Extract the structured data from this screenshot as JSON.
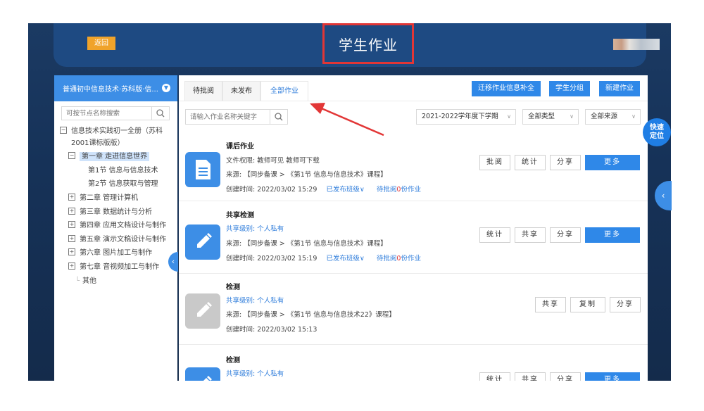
{
  "header": {
    "back_label": "返回",
    "title": "学生作业"
  },
  "sidebar": {
    "course": "普通初中信息技术·苏科版·信...",
    "search_placeholder": "可按节点名称搜索",
    "tree": [
      {
        "label": "信息技术实践初一全册（苏科",
        "expander": "−"
      },
      {
        "label": "2001课标版版）"
      },
      {
        "label": "第一章 走进信息世界",
        "expander": "−",
        "selected": true
      },
      {
        "label": "第1节 信息与信息技术"
      },
      {
        "label": "第2节 信息获取与管理"
      },
      {
        "label": "第二章 管理计算机",
        "expander": "+"
      },
      {
        "label": "第三章 数据统计与分析",
        "expander": "+"
      },
      {
        "label": "第四章 应用文档设计与制作",
        "expander": "+"
      },
      {
        "label": "第五章 演示文稿设计与制作",
        "expander": "+"
      },
      {
        "label": "第六章 图片加工与制作",
        "expander": "+"
      },
      {
        "label": "第七章 音视频加工与制作",
        "expander": "+"
      },
      {
        "label": "其他"
      }
    ]
  },
  "tabs": [
    "待批阅",
    "未发布",
    "全部作业"
  ],
  "active_tab": "全部作业",
  "toolbar": {
    "migrate": "迁移作业信息补全",
    "group": "学生分组",
    "new": "新建作业"
  },
  "filters": {
    "search_placeholder": "请输入作业名称关键字",
    "term": "2021-2022学年度下学期",
    "type": "全部类型",
    "source": "全部来源"
  },
  "float": {
    "locate": "快速定位"
  },
  "cards": [
    {
      "title": "课后作业",
      "line1": "文件权限:  教师可见  教师可下载",
      "source": "来源:   【同步备课 > 《第1节 信息与信息技术》课程】",
      "created": "创建时间:   2022/03/02 15:29",
      "published": "已发布班级∨",
      "pending_pre": "待批阅",
      "pending_num": "0",
      "pending_post": "份作业",
      "buttons": [
        "批阅",
        "统计",
        "分享",
        "更多"
      ]
    },
    {
      "title": "共享检测",
      "line1": "共享级别:  个人私有",
      "source": "来源:   【同步备课 > 《第1节 信息与信息技术》课程】",
      "created": "创建时间:   2022/03/02 15:19",
      "published": "已发布班级∨",
      "pending_pre": "待批阅",
      "pending_num": "0",
      "pending_post": "份作业",
      "buttons": [
        "统计",
        "共享",
        "分享",
        "更多"
      ]
    },
    {
      "title": "检测",
      "line1": "共享级别:  个人私有",
      "source": "来源:   【同步备课 > 《第1节 信息与信息技术22》课程】",
      "created": "创建时间:   2022/03/02 15:13",
      "buttons": [
        "共享",
        "复制",
        "分享"
      ]
    },
    {
      "title": "检测",
      "line1": "共享级别:  个人私有",
      "buttons": [
        "统计",
        "共享",
        "分享",
        "更多"
      ]
    }
  ],
  "colors": {
    "accent": "#2f88e8",
    "header_bg": "#1e4a82",
    "highlight_red": "#e23636",
    "back_button": "#f0a32a"
  }
}
